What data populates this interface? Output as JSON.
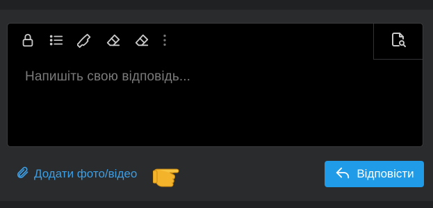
{
  "toolbar": {
    "icons": [
      "lock-icon",
      "list-icon",
      "phone-icon",
      "eraser-icon",
      "eraser-icon",
      "more-vertical-icon"
    ],
    "preview_icon": "document-search-icon"
  },
  "editor": {
    "placeholder": "Напишіть свою відповідь..."
  },
  "attach": {
    "label": "Додати фото/відео",
    "icon": "paperclip-icon"
  },
  "hint_icon": "pointing-hand-icon",
  "reply_button": {
    "label": "Відповісти",
    "icon": "reply-icon"
  },
  "colors": {
    "accent": "#1f9be8",
    "link": "#3c9ee4",
    "editor_bg": "#000000",
    "page_bg": "#2a2b2d"
  }
}
